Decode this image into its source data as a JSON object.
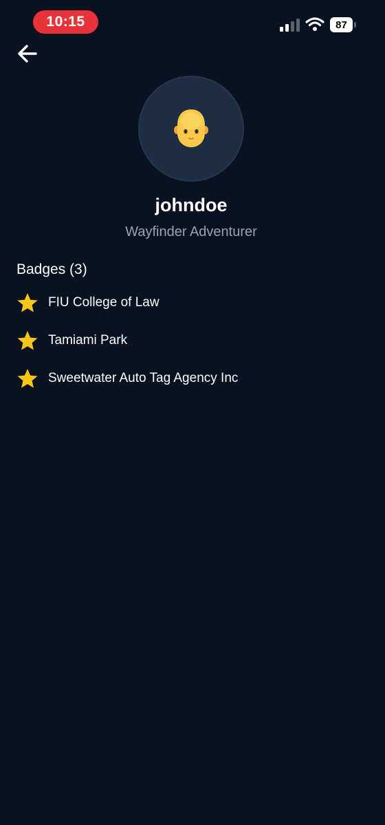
{
  "status_bar": {
    "time": "10:15",
    "battery": "87"
  },
  "profile": {
    "username": "johndoe",
    "title": "Wayfinder Adventurer"
  },
  "badges": {
    "heading": "Badges (3)",
    "items": [
      {
        "label": "FIU College of Law",
        "icon": "star-icon"
      },
      {
        "label": "Tamiami Park",
        "icon": "star-icon"
      },
      {
        "label": "Sweetwater Auto Tag Agency Inc",
        "icon": "star-icon"
      }
    ]
  },
  "colors": {
    "background": "#0a1221",
    "avatar_bg": "#1c2d44",
    "time_pill": "#e8333a",
    "star": "#f5c518",
    "subtitle": "#9aa3b0"
  }
}
